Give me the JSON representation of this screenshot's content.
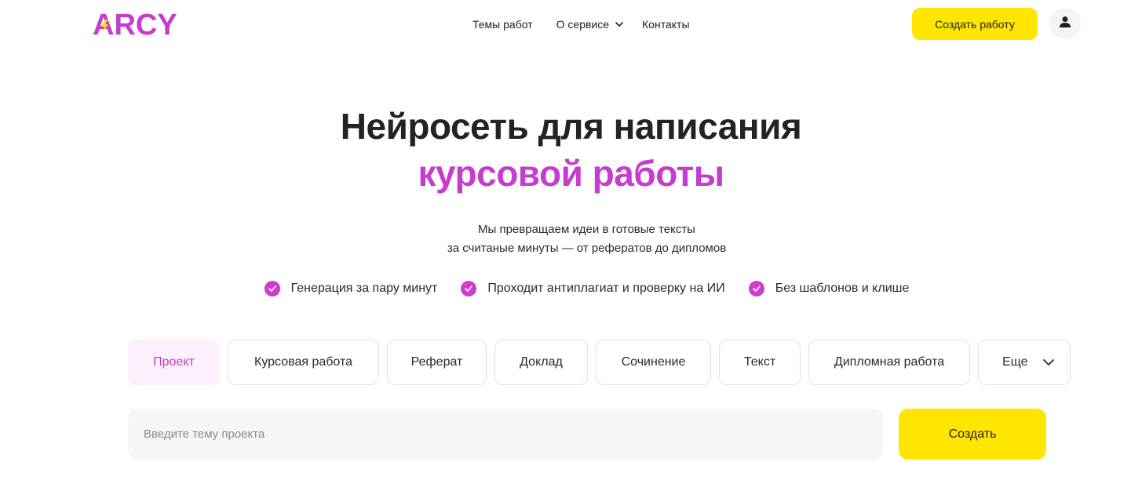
{
  "brand": {
    "logo_text": "ARCY",
    "logo_color": "#c63ccf",
    "bolt_color": "#ffe600"
  },
  "nav": {
    "items": [
      {
        "label": "Темы работ"
      },
      {
        "label": "О сервисе",
        "has_dropdown": true,
        "icon": "chevron-down-icon"
      },
      {
        "label": "Контакты"
      }
    ]
  },
  "header": {
    "cta_label": "Создать работу",
    "avatar_icon": "user-icon"
  },
  "hero": {
    "title_line1": "Нейросеть для написания",
    "title_line2": "курсовой работы",
    "subtitle_line1": "Мы превращаем идеи в готовые тексты",
    "subtitle_line2": "за считаные минуты — от рефератов до дипломов"
  },
  "features": [
    {
      "label": "Генерация за пару минут",
      "icon": "check-circle-icon"
    },
    {
      "label": "Проходит антиплагиат и проверку на ИИ",
      "icon": "check-circle-icon"
    },
    {
      "label": "Без шаблонов и клише",
      "icon": "check-circle-icon"
    }
  ],
  "tabs": {
    "items": [
      {
        "label": "Проект",
        "active": true
      },
      {
        "label": "Курсовая работа"
      },
      {
        "label": "Реферат"
      },
      {
        "label": "Доклад"
      },
      {
        "label": "Сочинение"
      },
      {
        "label": "Текст"
      },
      {
        "label": "Дипломная работа"
      }
    ],
    "more_label": "Еще"
  },
  "form": {
    "topic_placeholder": "Введите тему проекта",
    "topic_value": "",
    "submit_label": "Создать"
  },
  "colors": {
    "accent": "#c63ccf",
    "cta": "#ffe600",
    "active_tab_bg": "#fbf0fc",
    "input_bg": "#f6f6f8"
  }
}
